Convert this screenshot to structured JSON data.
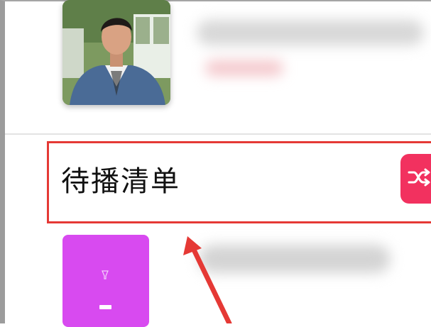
{
  "queue_section": {
    "title": "待播清单"
  },
  "icons": {
    "shuffle": "shuffle-icon",
    "glass": "glass-icon"
  },
  "colors": {
    "accent": "#f2315f",
    "highlight_box": "#e53935",
    "annotation_arrow": "#e53935",
    "artwork_bottom": "#d84af0"
  }
}
